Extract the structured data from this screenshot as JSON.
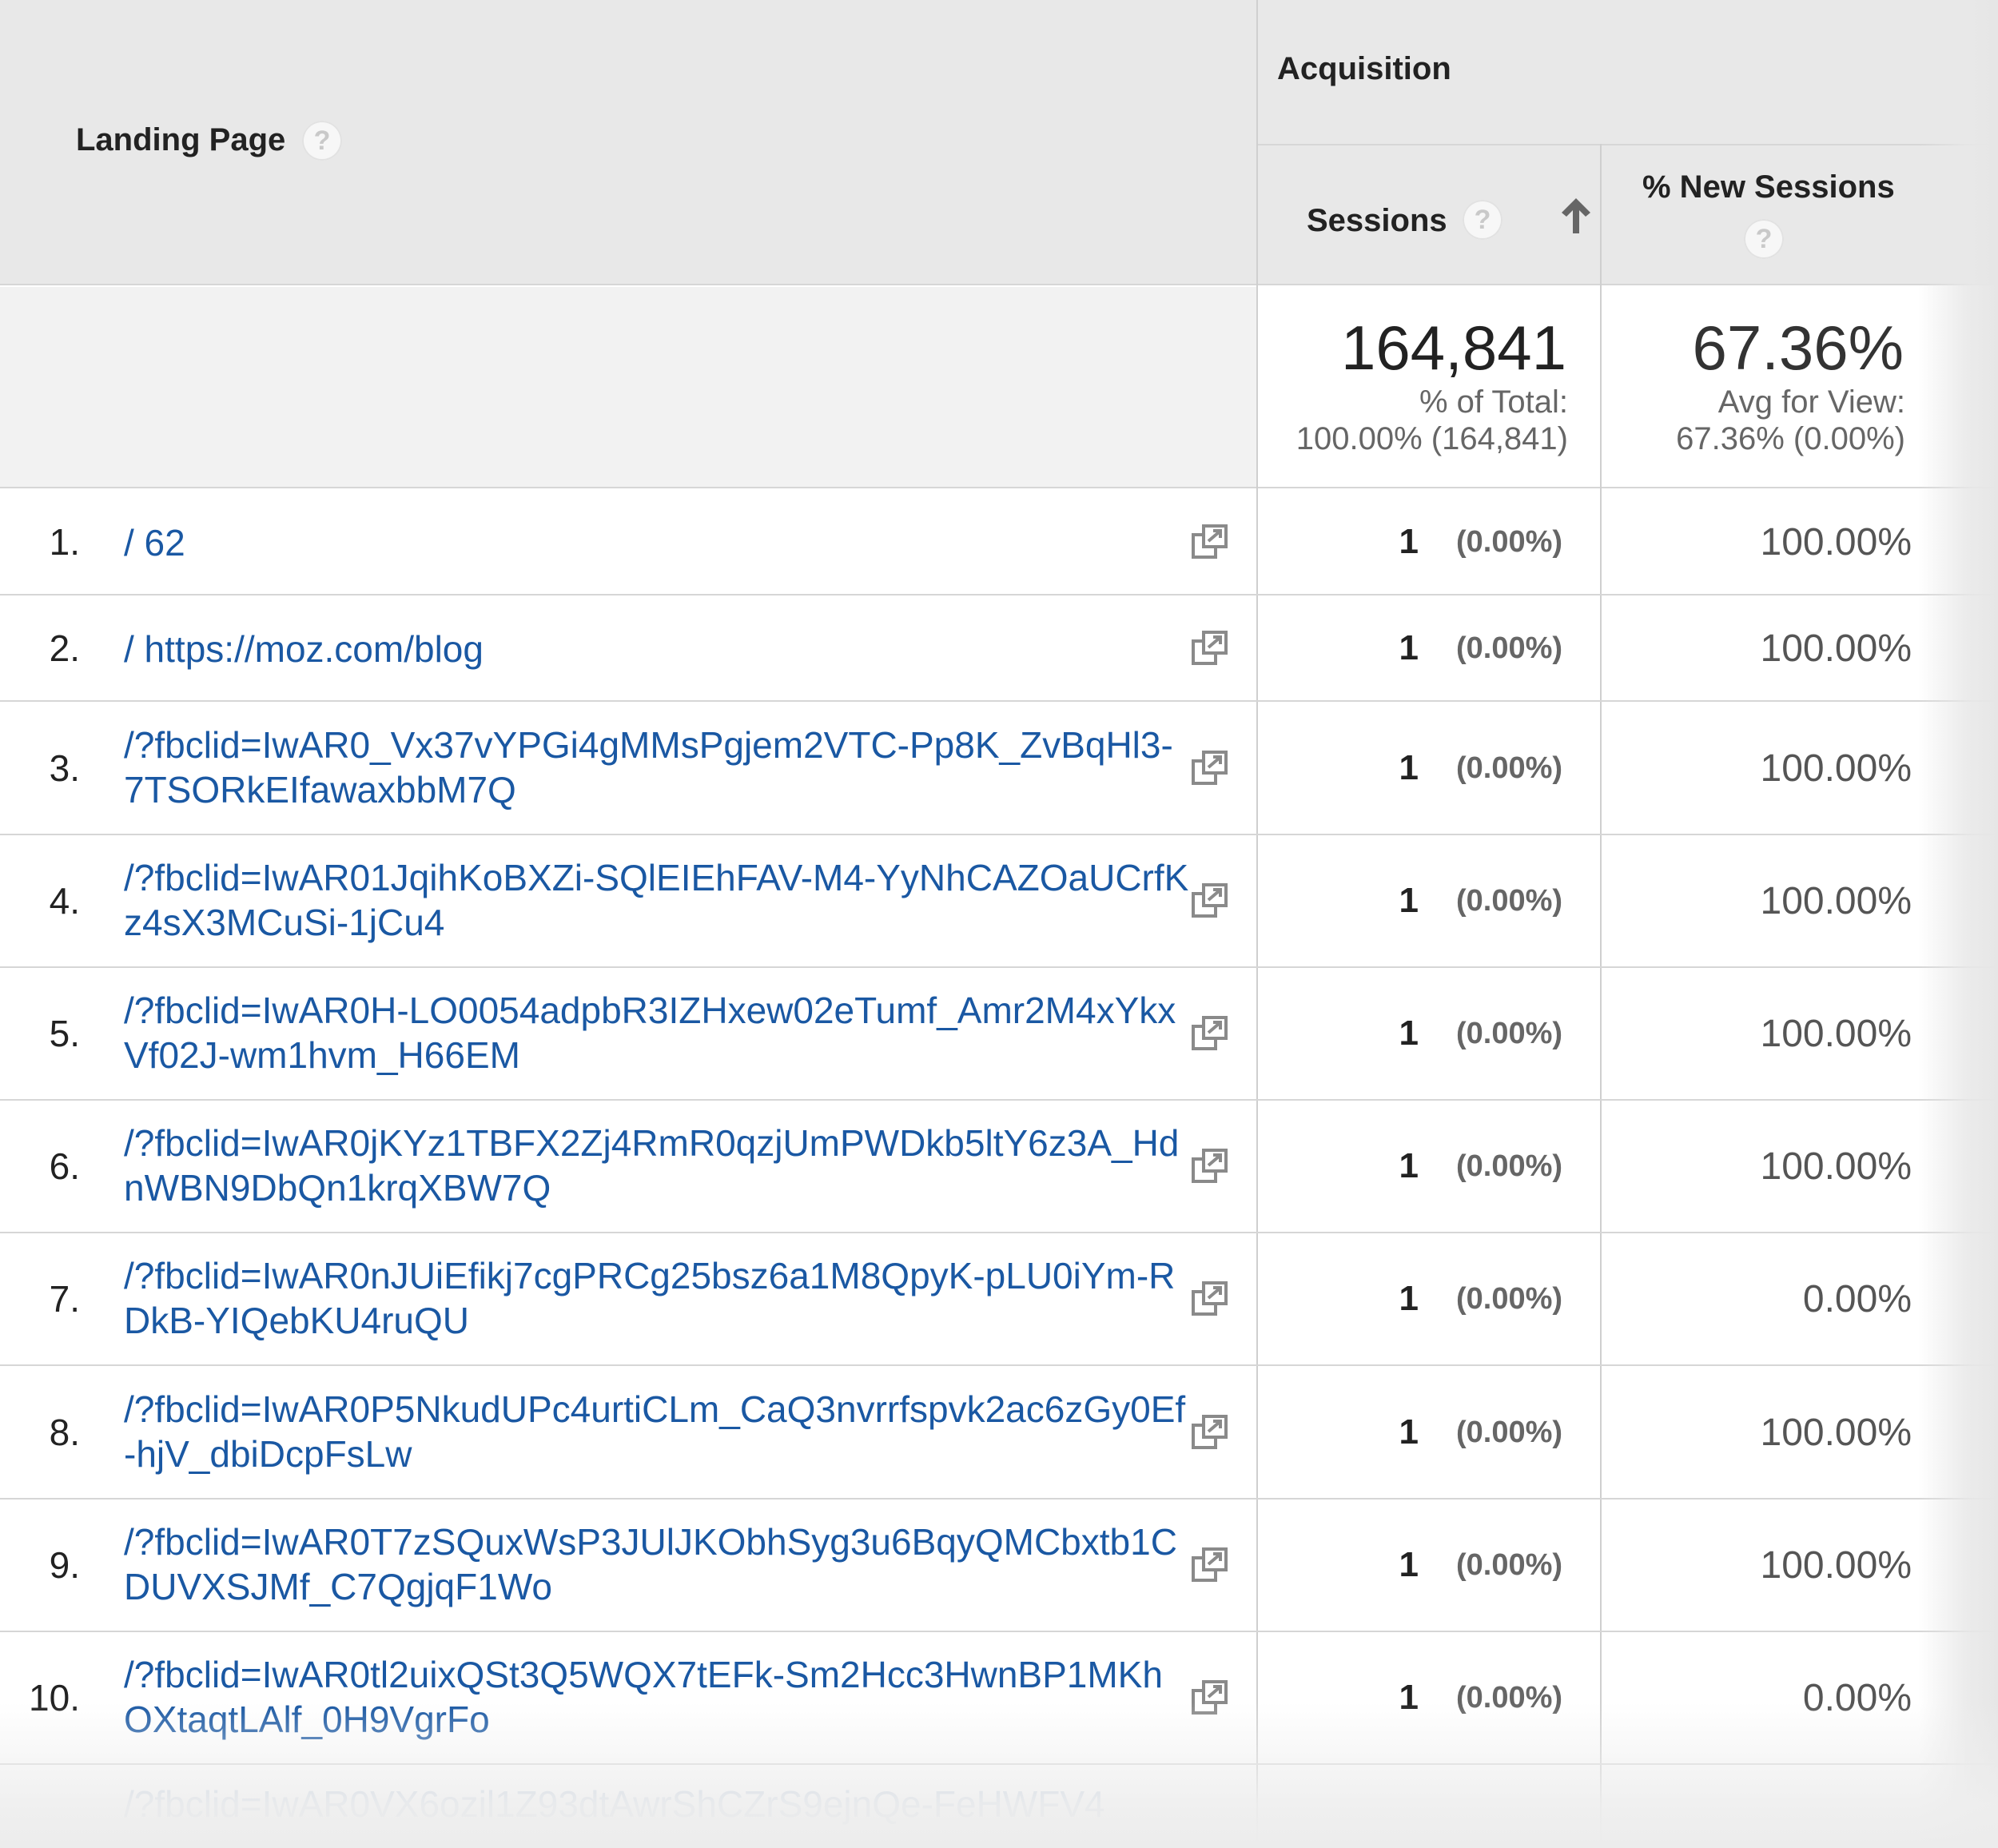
{
  "header": {
    "landing_page": "Landing Page",
    "acquisition": "Acquisition",
    "sessions": "Sessions",
    "new_sessions": "% New Sessions",
    "help_glyph": "?",
    "sort_direction": "ascending",
    "sort_icon": "arrow-up-icon"
  },
  "summary": {
    "sessions_total": "164,841",
    "sessions_sub1": "% of Total:",
    "sessions_sub2": "100.00% (164,841)",
    "new_sessions_total": "67.36%",
    "new_sessions_sub1": "Avg for View:",
    "new_sessions_sub2": "67.36% (0.00%)"
  },
  "rows": [
    {
      "num": "1.",
      "page": "/ 62",
      "sessions": "1",
      "pct": "(0.00%)",
      "new": "100.00%"
    },
    {
      "num": "2.",
      "page": "/ https://moz.com/blog",
      "sessions": "1",
      "pct": "(0.00%)",
      "new": "100.00%"
    },
    {
      "num": "3.",
      "page": "/?fbclid=IwAR0_Vx37vYPGi4gMMsPgjem2VTC-Pp8K_ZvBqHl3-7TSORkEIfawaxbbM7Q",
      "sessions": "1",
      "pct": "(0.00%)",
      "new": "100.00%"
    },
    {
      "num": "4.",
      "page": "/?fbclid=IwAR01JqihKoBXZi-SQlEIEhFAV-M4-YyNhCAZOaUCrfKz4sX3MCuSi-1jCu4",
      "sessions": "1",
      "pct": "(0.00%)",
      "new": "100.00%"
    },
    {
      "num": "5.",
      "page": "/?fbclid=IwAR0H-LO0054adpbR3IZHxew02eTumf_Amr2M4xYkxVf02J-wm1hvm_H66EM",
      "sessions": "1",
      "pct": "(0.00%)",
      "new": "100.00%"
    },
    {
      "num": "6.",
      "page": "/?fbclid=IwAR0jKYz1TBFX2Zj4RmR0qzjUmPWDkb5ltY6z3A_HdnWBN9DbQn1krqXBW7Q",
      "sessions": "1",
      "pct": "(0.00%)",
      "new": "100.00%"
    },
    {
      "num": "7.",
      "page": "/?fbclid=IwAR0nJUiEfikj7cgPRCg25bsz6a1M8QpyK-pLU0iYm-RDkB-YIQebKU4ruQU",
      "sessions": "1",
      "pct": "(0.00%)",
      "new": "0.00%"
    },
    {
      "num": "8.",
      "page": "/?fbclid=IwAR0P5NkudUPc4urtiCLm_CaQ3nvrrfspvk2ac6zGy0Ef-hjV_dbiDcpFsLw",
      "sessions": "1",
      "pct": "(0.00%)",
      "new": "100.00%"
    },
    {
      "num": "9.",
      "page": "/?fbclid=IwAR0T7zSQuxWsP3JUlJKObhSyg3u6BqyQMCbxtb1CDUVXSJMf_C7QgjqF1Wo",
      "sessions": "1",
      "pct": "(0.00%)",
      "new": "100.00%"
    },
    {
      "num": "10.",
      "page": "/?fbclid=IwAR0tl2uixQSt3Q5WQX7tEFk-Sm2Hcc3HwnBP1MKhOXtaqtLAlf_0H9VgrFo",
      "sessions": "1",
      "pct": "(0.00%)",
      "new": "0.00%"
    }
  ],
  "partial_row": {
    "page": "/?fbclid=IwAR0VX6ozil1Z93dtAwrShCZrS9ejnQe-FeHWFV4"
  },
  "icons": {
    "popout": "popout-window-icon",
    "help": "help-icon"
  },
  "colors": {
    "link": "#1a58a3",
    "header_bg": "#e8e8e8",
    "summary_bg": "#f2f2f2"
  }
}
